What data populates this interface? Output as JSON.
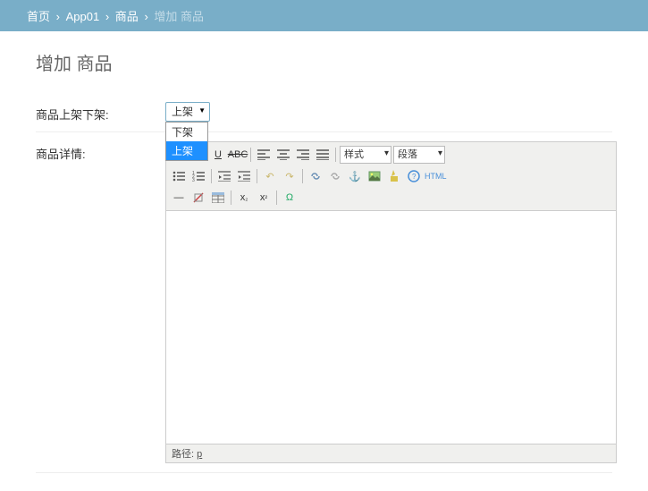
{
  "breadcrumb": {
    "home": "首页",
    "app": "App01",
    "model": "商品",
    "current": "增加 商品"
  },
  "page_title": "增加 商品",
  "fields": {
    "shelf": {
      "label": "商品上架下架:"
    },
    "detail": {
      "label": "商品详情:"
    }
  },
  "shelf_select": {
    "value": "上架",
    "options": [
      "下架",
      "上架"
    ],
    "selected_index": 1
  },
  "editor": {
    "style_select": "样式",
    "format_select": "段落",
    "status_prefix": "路径:",
    "status_path": "p",
    "html_label": "HTML"
  }
}
